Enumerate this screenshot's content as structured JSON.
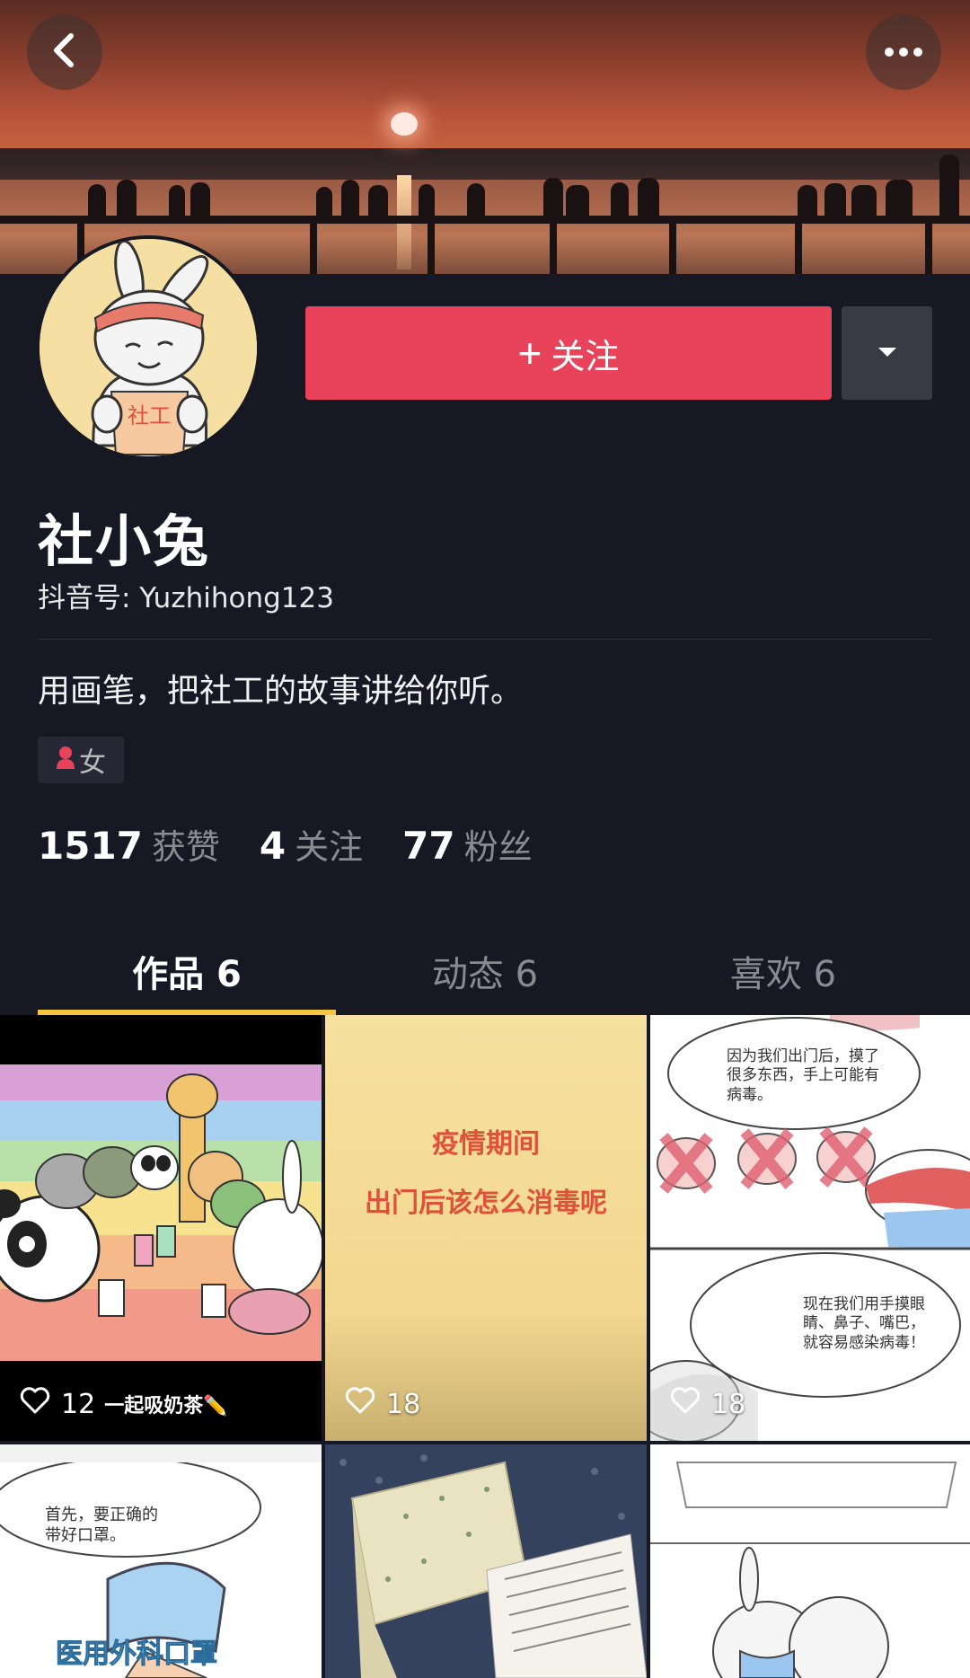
{
  "header": {
    "back_icon": "chevron-left-icon",
    "more_icon": "ellipsis-icon"
  },
  "profile": {
    "avatar_text": "社工",
    "follow_label": "关注",
    "follow_plus": "+",
    "dropdown_icon": "caret-down-icon",
    "nickname": "社小兔",
    "douyin_id": "抖音号: Yuzhihong123",
    "bio": "用画笔，把社工的故事讲给你听。",
    "gender": "女",
    "gender_icon": "person-icon",
    "accent_color": "#e8435a"
  },
  "stats": [
    {
      "value": "1517",
      "label": "获赞"
    },
    {
      "value": "4",
      "label": "关注"
    },
    {
      "value": "77",
      "label": "粉丝"
    }
  ],
  "tabs": [
    {
      "label": "作品 6",
      "active": true
    },
    {
      "label": "动态 6",
      "active": false
    },
    {
      "label": "喜欢 6",
      "active": false
    }
  ],
  "tab_indicator_color": "#f6c542",
  "videos": [
    {
      "likes": "12",
      "caption": "一起吸奶茶✏️"
    },
    {
      "likes": "18",
      "line1": "疫情期间",
      "line2": "出门后该怎么消毒呢"
    },
    {
      "likes": "18",
      "bubble1": "因为我们出门后，摸了很多东西，手上可能有病毒。",
      "bubble2": "现在我们用手摸眼睛、鼻子、嘴巴，就容易感染病毒！"
    },
    {
      "bubble": "首先，要正确的带好口罩。",
      "banner": "医用外科口罩"
    },
    {},
    {}
  ]
}
